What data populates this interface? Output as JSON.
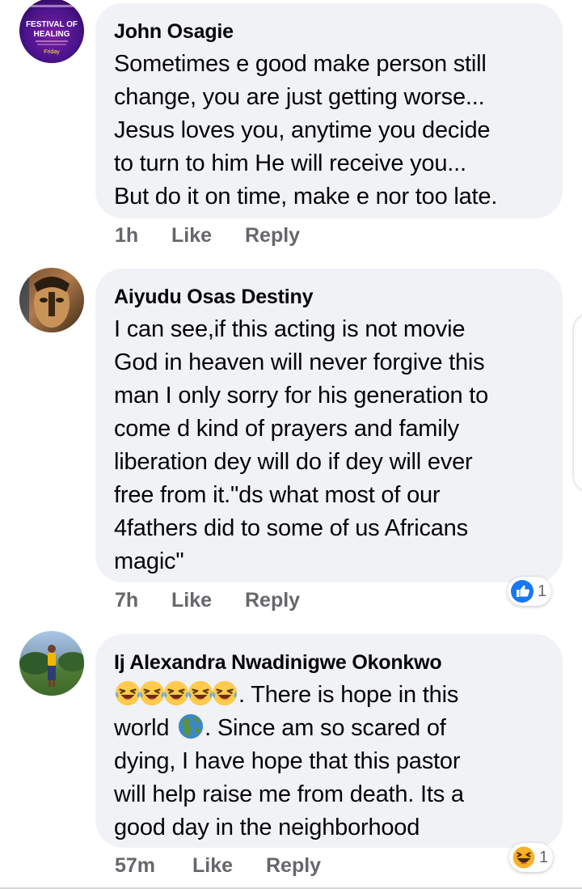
{
  "comments": [
    {
      "author": "John Osagie",
      "avatar_text": [
        "FESTIVAL OF",
        "HEALING",
        "Friday"
      ],
      "text_lines": [
        "Sometimes e good make person still",
        "change, you are just getting worse...",
        "Jesus loves you,  anytime you decide",
        "to turn to him He will receive you...",
        "But do it on time, make e nor too late."
      ],
      "time": "1h",
      "like": "Like",
      "reply": "Reply"
    },
    {
      "author": "Aiyudu Osas Destiny",
      "text_lines": [
        "I can see,if this acting is not movie",
        "God in heaven will never forgive this",
        "man I only sorry for his generation to",
        "come d kind of prayers and family",
        "liberation dey will do if dey will ever",
        "free from it.\"ds what most of our",
        "4fathers did to some of us Africans",
        "magic\""
      ],
      "time": "7h",
      "like": "Like",
      "reply": "Reply",
      "reaction": {
        "icon": "like-thumb-icon",
        "count": "1",
        "color": "#1877f2"
      }
    },
    {
      "author": "Ij Alexandra Nwadinigwe Okonkwo",
      "line1_suffix": ". There is hope in this",
      "line2_prefix": "world",
      "line2_suffix": ". Since am so scared of",
      "text_lines_rest": [
        "dying, I have hope that this pastor",
        "will help raise me from death.  Its a",
        "good day in the neighborhood"
      ],
      "emoji_row": [
        "rofl-emoji-icon",
        "rofl-emoji-icon",
        "rofl-emoji-icon",
        "rofl-emoji-icon",
        "rofl-emoji-icon"
      ],
      "globe_icon": "globe-americas-icon",
      "time": "57m",
      "like": "Like",
      "reply": "Reply",
      "reaction": {
        "icon": "haha-emoji-icon",
        "count": "1",
        "color": "#f7b125"
      }
    }
  ]
}
